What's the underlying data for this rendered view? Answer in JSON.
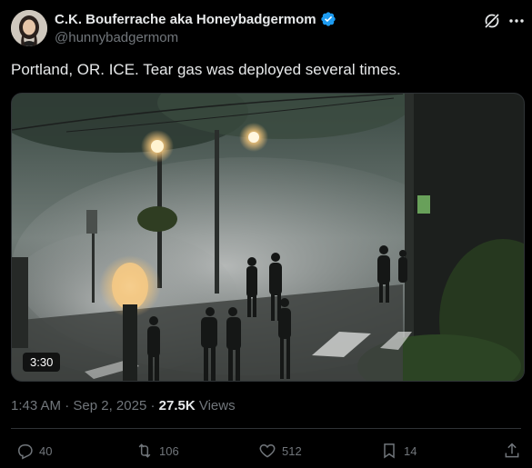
{
  "author": {
    "display_name": "C.K. Bouferrache aka Honeybadgermom",
    "handle": "@hunnybadgermom",
    "verified": true
  },
  "tweet": {
    "text": "Portland, OR. ICE. Tear gas was deployed several times."
  },
  "media": {
    "type": "video",
    "duration": "3:30"
  },
  "meta": {
    "time": "1:43 AM",
    "separator": "·",
    "date": "Sep 2, 2025",
    "views_count": "27.5K",
    "views_label": "Views"
  },
  "actions": {
    "replies": "40",
    "reposts": "106",
    "likes": "512",
    "bookmarks": "14"
  },
  "icons": [
    "verified-badge-icon",
    "grok-icon",
    "more-icon",
    "reply-icon",
    "repost-icon",
    "like-icon",
    "bookmark-icon",
    "share-icon"
  ],
  "colors": {
    "background": "#000000",
    "text": "#e7e9ea",
    "muted": "#71767b",
    "verified": "#1d9bf0"
  }
}
